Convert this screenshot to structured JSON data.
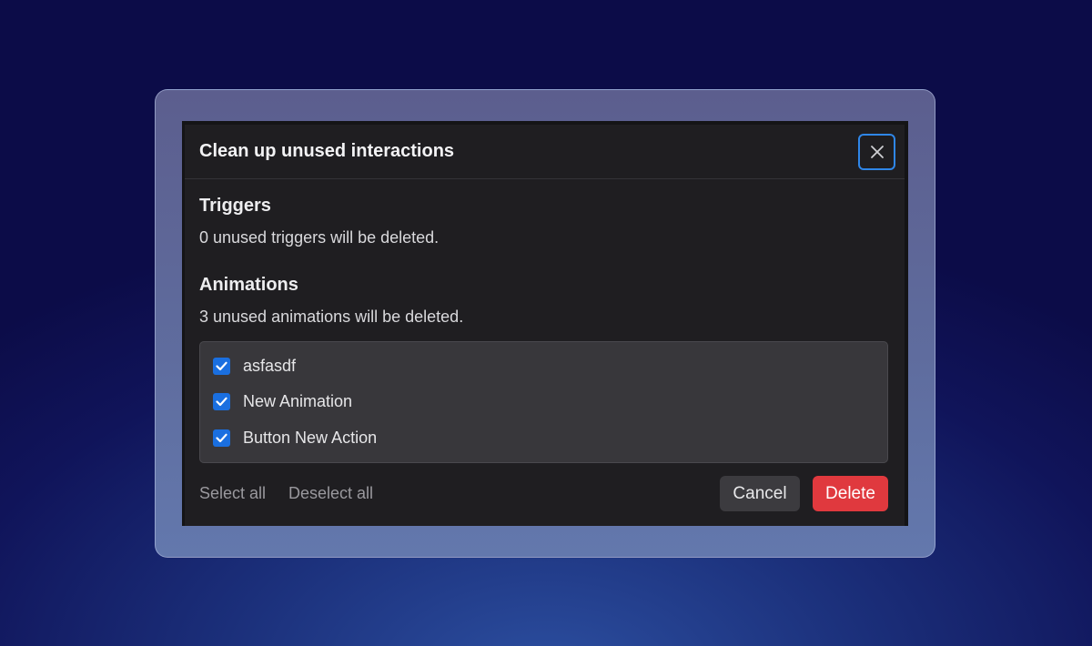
{
  "dialog": {
    "title": "Clean up unused interactions",
    "close_icon": "close-icon"
  },
  "triggers": {
    "heading": "Triggers",
    "description": "0 unused triggers will be deleted."
  },
  "animations": {
    "heading": "Animations",
    "description": "3 unused animations will be deleted.",
    "items": [
      {
        "label": "asfasdf",
        "checked": true
      },
      {
        "label": "New Animation",
        "checked": true
      },
      {
        "label": "Button New Action",
        "checked": true
      }
    ]
  },
  "footer": {
    "select_all": "Select all",
    "deselect_all": "Deselect all",
    "cancel": "Cancel",
    "delete": "Delete"
  },
  "colors": {
    "accent": "#2f86e8",
    "checkbox": "#1a6fe0",
    "danger": "#e0393e"
  }
}
